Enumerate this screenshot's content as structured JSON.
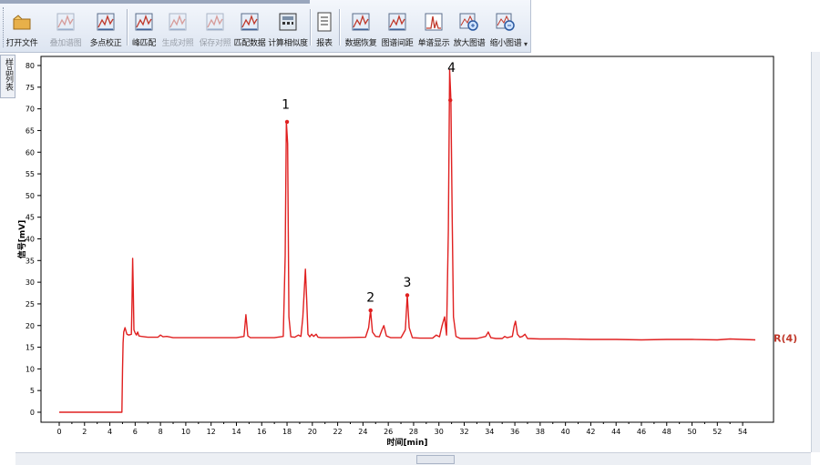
{
  "toolbar": {
    "items": [
      {
        "label": "打开文件",
        "icon": "folder-icon",
        "enabled": true
      },
      {
        "label": "叠加谱图",
        "icon": "overlay-spectrum-icon",
        "enabled": false
      },
      {
        "label": "多点校正",
        "icon": "multipoint-calibration-icon",
        "enabled": true
      },
      {
        "label": "峰匹配",
        "icon": "peak-match-icon",
        "enabled": true
      },
      {
        "label": "生成对照",
        "icon": "generate-reference-icon",
        "enabled": false
      },
      {
        "label": "保存对照",
        "icon": "save-reference-icon",
        "enabled": false
      },
      {
        "label": "匹配数据",
        "icon": "match-data-icon",
        "enabled": true
      },
      {
        "label": "计算相似度",
        "icon": "similarity-calculator-icon",
        "enabled": true
      },
      {
        "label": "报表",
        "icon": "report-icon",
        "enabled": true
      },
      {
        "label": "数据恢复",
        "icon": "data-restore-icon",
        "enabled": true
      },
      {
        "label": "图谱间距",
        "icon": "spectrum-spacing-icon",
        "enabled": true
      },
      {
        "label": "单谱显示",
        "icon": "single-spectrum-icon",
        "enabled": true
      },
      {
        "label": "放大图谱",
        "icon": "zoom-in-icon",
        "enabled": true
      },
      {
        "label": "缩小图谱",
        "icon": "zoom-out-icon",
        "enabled": true
      }
    ]
  },
  "side_tab": {
    "label": "样品列表"
  },
  "chart_data": {
    "type": "line",
    "xlabel": "时间[min]",
    "ylabel": "信号[mV]",
    "xlim": [
      0,
      55
    ],
    "ylim": [
      0,
      80
    ],
    "xticks": [
      0,
      2,
      4,
      6,
      8,
      10,
      12,
      14,
      16,
      18,
      20,
      22,
      24,
      26,
      28,
      30,
      32,
      34,
      36,
      38,
      40,
      42,
      44,
      46,
      48,
      50,
      52,
      54
    ],
    "yticks": [
      0,
      5,
      10,
      15,
      20,
      25,
      30,
      35,
      40,
      45,
      50,
      55,
      60,
      65,
      70,
      75,
      80
    ],
    "series": [
      {
        "name": "R(4)",
        "color": "#e02020",
        "x": [
          0,
          4.95,
          5.0,
          5.05,
          5.1,
          5.2,
          5.35,
          5.5,
          5.7,
          5.75,
          5.8,
          5.85,
          5.9,
          6.0,
          6.1,
          6.2,
          6.3,
          6.5,
          7,
          7.8,
          8.0,
          8.2,
          8.5,
          9,
          10,
          12,
          14,
          14.6,
          14.75,
          14.9,
          15.1,
          16,
          17,
          17.7,
          17.85,
          17.95,
          18.05,
          18.15,
          18.3,
          18.6,
          18.9,
          19.1,
          19.25,
          19.45,
          19.55,
          19.65,
          19.8,
          19.95,
          20.1,
          20.3,
          20.45,
          20.7,
          22,
          24.2,
          24.45,
          24.6,
          24.75,
          25,
          25.3,
          25.5,
          25.65,
          25.85,
          26.2,
          27,
          27.35,
          27.5,
          27.65,
          27.9,
          28.5,
          29.5,
          29.8,
          30.05,
          30.25,
          30.45,
          30.6,
          30.75,
          30.85,
          30.95,
          31.05,
          31.15,
          31.35,
          31.7,
          33,
          33.7,
          33.9,
          34.1,
          34.5,
          35,
          35.2,
          35.4,
          35.8,
          35.95,
          36.05,
          36.2,
          36.4,
          36.6,
          36.8,
          37,
          38,
          40,
          42,
          44,
          46,
          48,
          50,
          52,
          53,
          55
        ],
        "y": [
          0,
          0,
          10,
          16,
          18.5,
          19.5,
          18,
          17.8,
          18,
          25.5,
          35.5,
          28,
          19,
          18.3,
          17.8,
          18.5,
          17.6,
          17.5,
          17.3,
          17.3,
          17.8,
          17.4,
          17.5,
          17.2,
          17.2,
          17.2,
          17.2,
          17.5,
          22.5,
          17.6,
          17.2,
          17.2,
          17.2,
          17.5,
          36,
          67,
          62,
          22,
          17.4,
          17.3,
          17.8,
          17.5,
          22,
          33,
          26,
          18,
          17.4,
          18,
          17.5,
          18,
          17.3,
          17.2,
          17.2,
          17.3,
          19.5,
          23.5,
          18.5,
          17.5,
          17.4,
          19,
          20,
          17.6,
          17.2,
          17.2,
          19,
          27,
          19.5,
          17.2,
          17.1,
          17.1,
          17.8,
          17.4,
          20,
          22,
          17.8,
          42,
          79,
          72,
          45,
          22,
          17.5,
          17,
          17,
          17.5,
          18.5,
          17.2,
          17,
          17,
          17.5,
          17.2,
          17.5,
          20,
          21,
          18,
          17.3,
          17.5,
          18,
          17,
          16.9,
          16.9,
          16.8,
          16.8,
          16.7,
          16.8,
          16.8,
          16.7,
          16.9,
          16.7
        ]
      }
    ],
    "annotations": [
      {
        "text": "1",
        "x": 17.9,
        "y": 70
      },
      {
        "text": "2",
        "x": 24.6,
        "y": 25.5
      },
      {
        "text": "3",
        "x": 27.5,
        "y": 29
      },
      {
        "text": "4",
        "x": 31.0,
        "y": 78.5
      }
    ],
    "markers": [
      {
        "x": 18.0,
        "y": 67
      },
      {
        "x": 24.6,
        "y": 23.5
      },
      {
        "x": 27.5,
        "y": 27
      },
      {
        "x": 30.9,
        "y": 72
      }
    ],
    "series_label": "R(4)"
  }
}
